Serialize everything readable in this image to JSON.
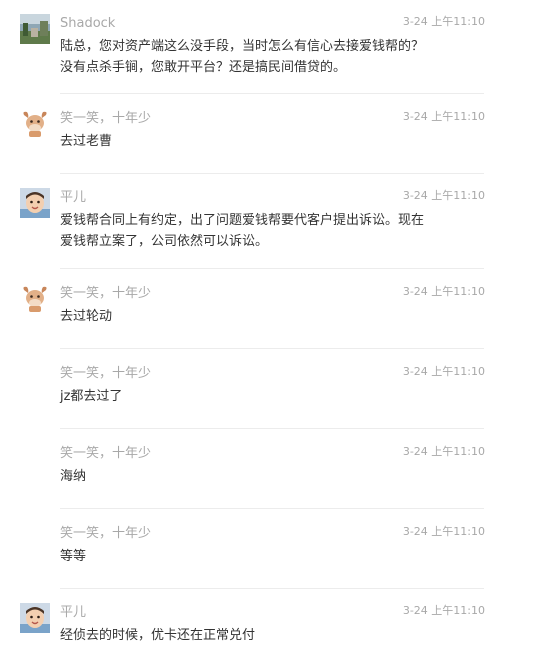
{
  "comments": [
    {
      "user": "Shadock",
      "avatar": "photo",
      "time": "3-24 上午11:10",
      "lines": [
        "陆总，您对资产端这么没手段，当时怎么有信心去接爱钱帮的？",
        "没有点杀手锏，您敢开平台？还是搞民间借贷的。"
      ]
    },
    {
      "user": "笑一笑，十年少",
      "avatar": "cartoon-cow",
      "time": "3-24 上午11:10",
      "lines": [
        "去过老曹"
      ]
    },
    {
      "user": "平儿",
      "avatar": "baby-photo",
      "time": "3-24 上午11:10",
      "lines": [
        "爱钱帮合同上有约定，出了问题爱钱帮要代客户提出诉讼。现在",
        "爱钱帮立案了，公司依然可以诉讼。"
      ]
    },
    {
      "user": "笑一笑，十年少",
      "avatar": "cartoon-cow",
      "time": "3-24 上午11:10",
      "lines": [
        "去过轮动"
      ]
    },
    {
      "user": "笑一笑，十年少",
      "avatar": "none",
      "time": "3-24 上午11:10",
      "lines": [
        "jz都去过了"
      ]
    },
    {
      "user": "笑一笑，十年少",
      "avatar": "none",
      "time": "3-24 上午11:10",
      "lines": [
        "海纳"
      ]
    },
    {
      "user": "笑一笑，十年少",
      "avatar": "none",
      "time": "3-24 上午11:10",
      "lines": [
        "等等"
      ]
    },
    {
      "user": "平儿",
      "avatar": "baby-photo",
      "time": "3-24 上午11:10",
      "lines": [
        "经侦去的时候，优卡还在正常兑付"
      ]
    }
  ]
}
